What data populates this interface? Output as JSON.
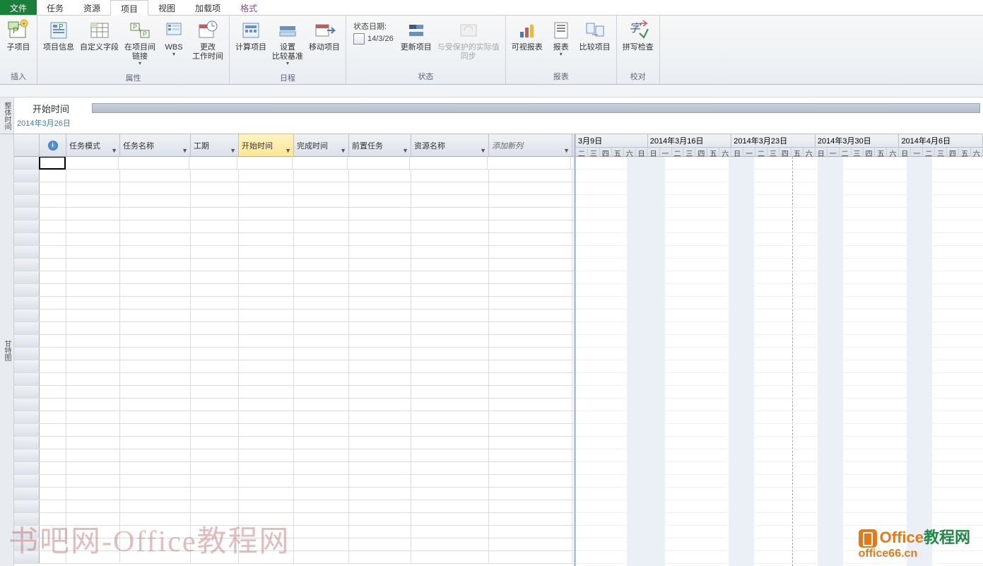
{
  "tabs": {
    "file": "文件",
    "task": "任务",
    "resource": "资源",
    "project": "项目",
    "view": "视图",
    "addin": "加载项",
    "format": "格式"
  },
  "ribbon": {
    "groups": {
      "insert": {
        "label": "插入",
        "subproject": "子项目"
      },
      "props": {
        "label": "属性",
        "projinfo": "项目信息",
        "customfields": "自定义字段",
        "links": "在项目间\n链接",
        "wbs": "WBS",
        "changework": "更改\n工作时间"
      },
      "schedule": {
        "label": "日程",
        "calcproj": "计算项目",
        "setbaseline": "设置\n比较基准",
        "moveproj": "移动项目"
      },
      "status": {
        "label": "状态",
        "statusdate_label": "状态日期:",
        "statusdate_value": "14/3/26",
        "updateproj": "更新项目",
        "syncprotected": "与受保护的实际值\n同步"
      },
      "report": {
        "label": "报表",
        "visualreport": "可视报表",
        "report": "报表",
        "compare": "比较项目"
      },
      "proof": {
        "label": "校对",
        "spell": "拼写检查"
      }
    }
  },
  "timeline": {
    "vlabel": "整体时间",
    "title": "开始时间",
    "date": "2014年3月26日"
  },
  "grid": {
    "vlabel": "甘特图",
    "cols": {
      "rowhead": "",
      "info": "i",
      "mode": "任务模式",
      "name": "任务名称",
      "duration": "工期",
      "start": "开始时间",
      "finish": "完成时间",
      "pred": "前置任务",
      "res": "资源名称",
      "add": "添加新列"
    },
    "widths": {
      "rowhead": 36,
      "info": 38,
      "mode": 76,
      "name": 100,
      "duration": 68,
      "start": 78,
      "finish": 78,
      "pred": 88,
      "res": 110,
      "add": 118
    }
  },
  "gantt": {
    "weeks": [
      "3月9日",
      "2014年3月16日",
      "2014年3月23日",
      "2014年3月30日",
      "2014年4月6日"
    ],
    "firstWeekDays": [
      "二",
      "三",
      "四",
      "五",
      "六",
      "日"
    ],
    "days": [
      "日",
      "一",
      "二",
      "三",
      "四",
      "五",
      "六"
    ],
    "todayOffset": 17
  },
  "watermark": {
    "left": "书吧网-Office教程网",
    "r1a": "Office",
    "r1b": "教程网",
    "r2": "office66.cn"
  }
}
